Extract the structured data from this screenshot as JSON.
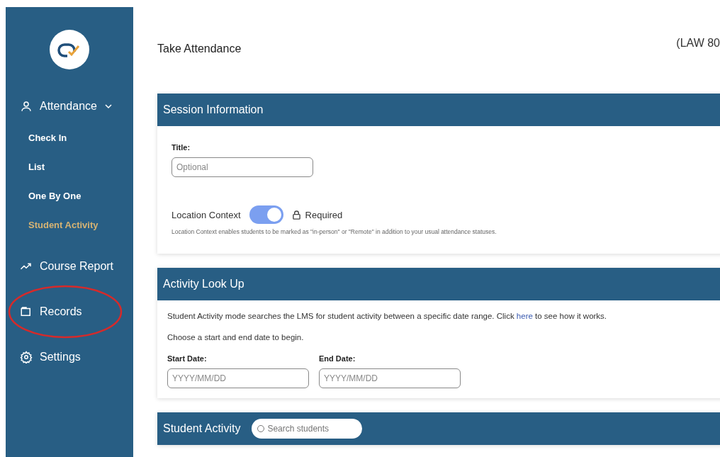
{
  "sidebar": {
    "items": [
      {
        "kind": "group",
        "label": "Attendance",
        "expanded": true,
        "circled": false,
        "children": [
          {
            "label": "Check In",
            "selected": false
          },
          {
            "label": "List",
            "selected": false
          },
          {
            "label": "One By One",
            "selected": false
          },
          {
            "label": "Student Activity",
            "selected": true
          }
        ]
      },
      {
        "kind": "link",
        "label": "Course Report",
        "circled": false
      },
      {
        "kind": "link",
        "label": "Records",
        "circled": true
      },
      {
        "kind": "link",
        "label": "Settings",
        "circled": false
      }
    ]
  },
  "page": {
    "title": "Take Attendance",
    "course": "(LAW 80"
  },
  "session": {
    "heading": "Session Information",
    "title_label": "Title:",
    "title_placeholder": "Optional",
    "location_label": "Location Context",
    "location_on": true,
    "required": "Required",
    "note": "Location Context enables students to be marked as \"in-person\" or \"Remote\" in addition to your usual attendance statuses."
  },
  "lookup": {
    "heading": "Activity Look Up",
    "text_before": "Student Activity mode searches the LMS for student activity between a specific date range. Click ",
    "link": "here",
    "text_after": " to see how it works.",
    "instruction": "Choose a start and end date to begin.",
    "dates": [
      {
        "label": "Start Date:",
        "placeholder": "YYYY/MM/DD"
      },
      {
        "label": "End Date:",
        "placeholder": "YYYY/MM/DD"
      }
    ]
  },
  "activity": {
    "heading": "Student Activity",
    "search_placeholder": "Search students"
  }
}
